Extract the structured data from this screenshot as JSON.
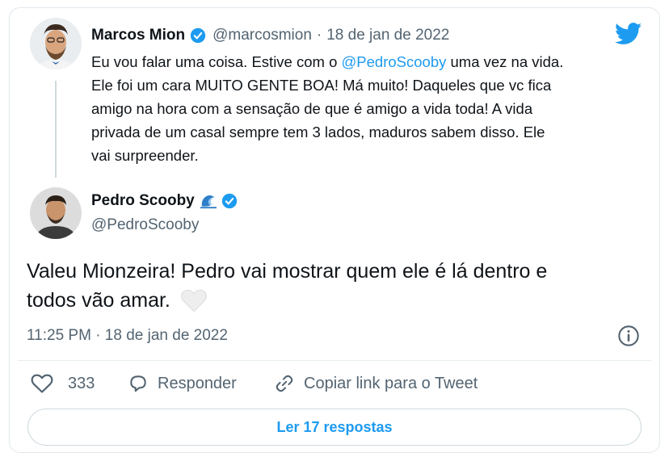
{
  "quoted_tweet": {
    "name": "Marcos Mion",
    "handle": "@marcosmion",
    "separator": "·",
    "date": "18 de jan de 2022",
    "lines": [
      {
        "before": "Eu vou falar uma coisa. Estive com o ",
        "mention": "@PedroScooby",
        "after": " uma vez na vida."
      },
      {
        "before": "Ele foi um cara MUITO GENTE BOA! Má muito! Daqueles que vc fica"
      },
      {
        "before": "amigo na hora com a sensação de que é amigo a vida toda! A vida"
      },
      {
        "before": "privada de um casal sempre tem 3 lados, maduros sabem disso. Ele"
      },
      {
        "before": "vai surpreender."
      }
    ]
  },
  "main_tweet": {
    "name": "Pedro Scooby",
    "handle": "@PedroScooby",
    "text_line1": "Valeu Mionzeira! Pedro vai mostrar quem ele é lá dentro e",
    "text_line2": "todos vão amar.",
    "time": "11:25 PM · 18 de jan de 2022"
  },
  "actions": {
    "like_count": "333",
    "reply_label": "Responder",
    "copy_link_label": "Copiar link para o Tweet"
  },
  "read_replies_label": "Ler 17 respostas",
  "colors": {
    "accent": "#1d9bf0",
    "text": "#0f1419",
    "muted": "#536471",
    "border": "#cfd9de"
  }
}
